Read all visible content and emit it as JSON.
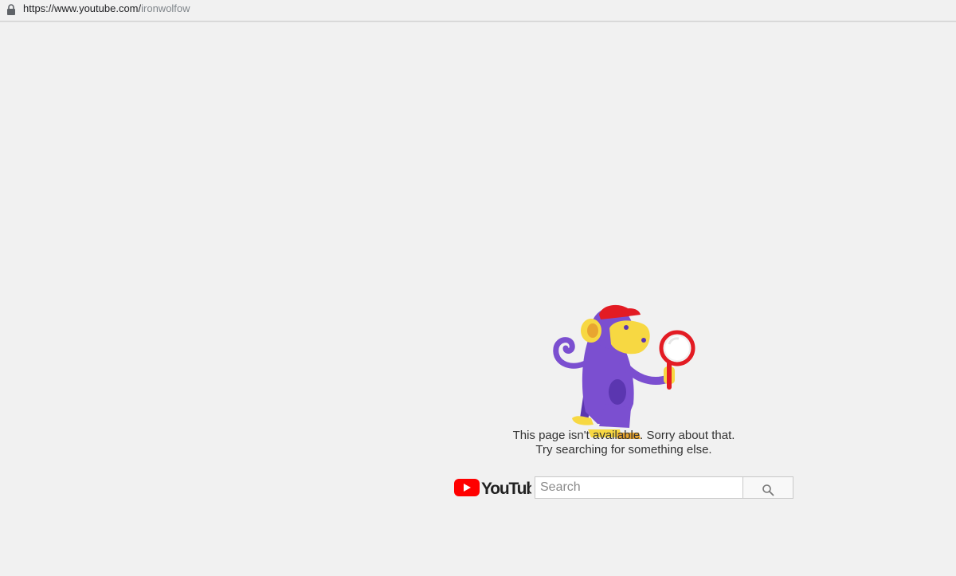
{
  "address_bar": {
    "url_prefix": "https://www.youtube.com/",
    "url_path": "ironwolfow",
    "lock_icon": "lock-icon"
  },
  "error": {
    "illustration_icon": "monkey-with-magnifier-icon",
    "line1": "This page isn't available. Sorry about that.",
    "line2": "Try searching for something else."
  },
  "search": {
    "logo_text": "YouTube",
    "placeholder": "Search",
    "button_icon": "search-icon"
  },
  "colors": {
    "background": "#f1f1f1",
    "youtube_red": "#ff0000",
    "monkey_purple": "#7b4fd0",
    "monkey_face": "#f7d842",
    "hat_red": "#e31b23"
  }
}
